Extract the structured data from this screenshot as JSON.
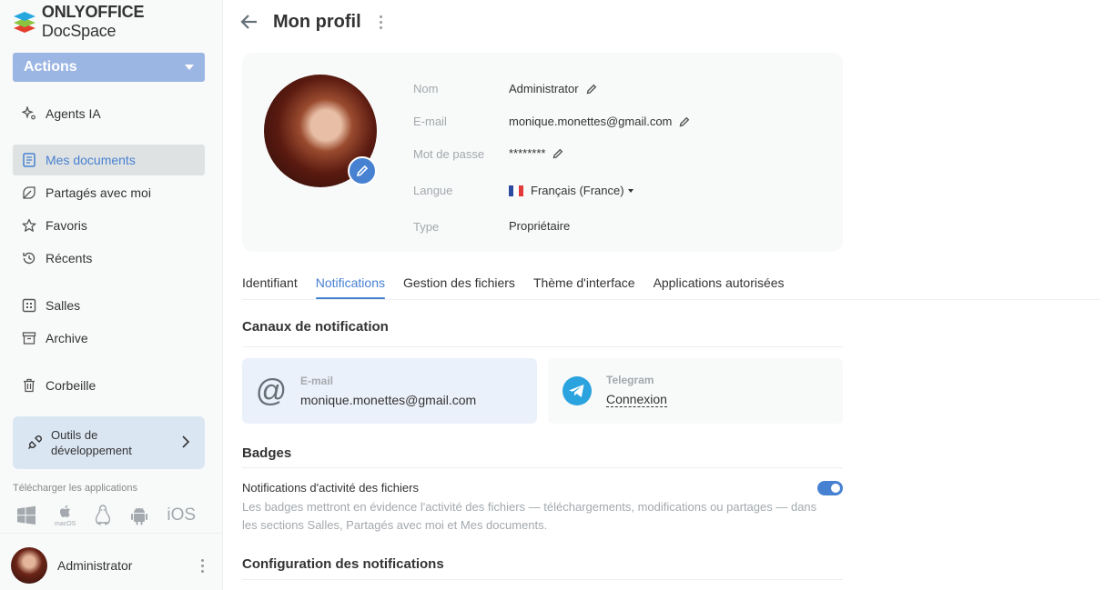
{
  "app": {
    "brand_bold": "ONLYOFFICE",
    "brand_light": "DocSpace"
  },
  "sidebar": {
    "actions_label": "Actions",
    "items": [
      {
        "label": "Agents IA",
        "icon": "sparkle-icon"
      },
      {
        "label": "Mes documents",
        "icon": "document-icon",
        "active": true
      },
      {
        "label": "Partagés avec moi",
        "icon": "shared-icon"
      },
      {
        "label": "Favoris",
        "icon": "star-icon"
      },
      {
        "label": "Récents",
        "icon": "history-icon"
      },
      {
        "label": "Salles",
        "icon": "rooms-icon"
      },
      {
        "label": "Archive",
        "icon": "archive-icon"
      },
      {
        "label": "Corbeille",
        "icon": "trash-icon"
      }
    ],
    "dev_tools_label": "Outils de développement",
    "download_label": "Télécharger les applications",
    "apps": [
      "Windows",
      "macOS",
      "Linux",
      "Android",
      "iOS"
    ],
    "macos_label": "macOS",
    "ios_label": "iOS",
    "user_name": "Administrator"
  },
  "header": {
    "title": "Mon profil"
  },
  "profile": {
    "name_label": "Nom",
    "name_value": "Administrator",
    "email_label": "E-mail",
    "email_value": "monique.monettes@gmail.com",
    "password_label": "Mot de passe",
    "password_value": "********",
    "language_label": "Langue",
    "language_value": "Français (France)",
    "type_label": "Type",
    "type_value": "Propriétaire"
  },
  "tabs": [
    "Identifiant",
    "Notifications",
    "Gestion des fichiers",
    "Thème d'interface",
    "Applications autorisées"
  ],
  "active_tab": "Notifications",
  "notifications": {
    "channels_title": "Canaux de notification",
    "email_label": "E-mail",
    "email_value": "monique.monettes@gmail.com",
    "telegram_label": "Telegram",
    "telegram_action": "Connexion",
    "badges_title": "Badges",
    "file_activity_title": "Notifications d'activité des fichiers",
    "file_activity_desc": "Les badges mettront en évidence l'activité des fichiers — téléchargements, modifications ou partages — dans les sections Salles, Partagés avec moi et Mes documents.",
    "file_activity_enabled": true,
    "config_title": "Configuration des notifications"
  },
  "colors": {
    "accent": "#4781d1",
    "actions_bg": "#9cb6e3",
    "telegram": "#2aa3df"
  }
}
